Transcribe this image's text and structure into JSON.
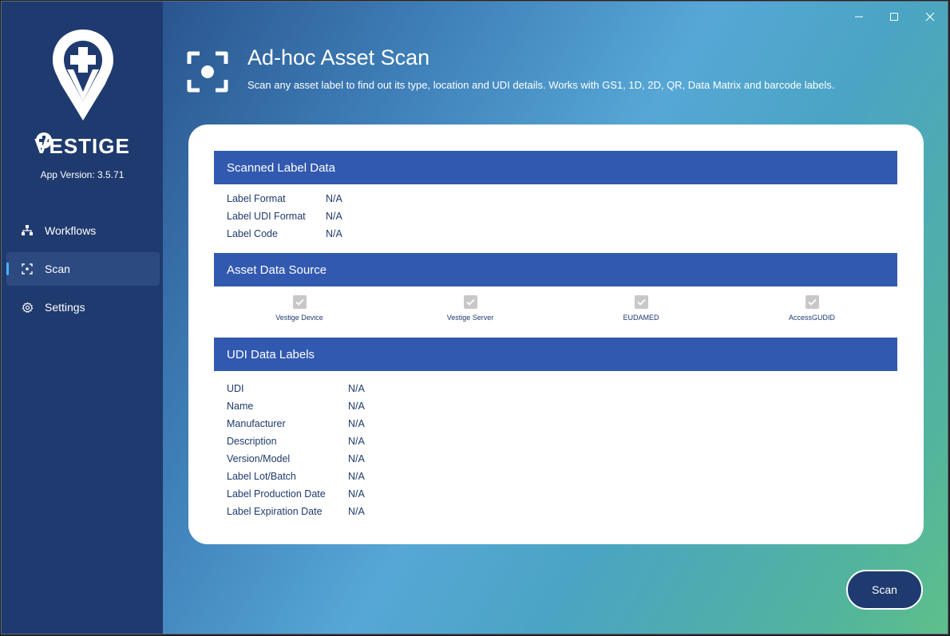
{
  "app": {
    "brand": "VESTIGE",
    "version": "App Version: 3.5.71"
  },
  "sidebar": {
    "items": [
      {
        "label": "Workflows",
        "icon": "workflow-icon"
      },
      {
        "label": "Scan",
        "icon": "scan-icon",
        "active": true
      },
      {
        "label": "Settings",
        "icon": "gear-icon"
      }
    ]
  },
  "titlebar": {
    "minimize": "minimize-icon",
    "maximize": "maximize-icon",
    "close": "close-icon"
  },
  "page": {
    "title": "Ad-hoc Asset Scan",
    "subtitle": "Scan any asset label to find out its type, location and UDI details. Works with GS1, 1D, 2D, QR, Data Matrix and barcode labels."
  },
  "scanned": {
    "heading": "Scanned Label Data",
    "rows": [
      {
        "key": "Label Format",
        "value": "N/A"
      },
      {
        "key": "Label UDI Format",
        "value": "N/A"
      },
      {
        "key": "Label Code",
        "value": "N/A"
      }
    ]
  },
  "sources": {
    "heading": "Asset Data Source",
    "items": [
      {
        "label": "Vestige Device",
        "checked": true
      },
      {
        "label": "Vestige Server",
        "checked": true
      },
      {
        "label": "EUDAMED",
        "checked": true
      },
      {
        "label": "AccessGUDID",
        "checked": true
      }
    ]
  },
  "udi": {
    "heading": "UDI Data Labels",
    "rows": [
      {
        "key": "UDI",
        "value": "N/A"
      },
      {
        "key": "Name",
        "value": "N/A"
      },
      {
        "key": "Manufacturer",
        "value": "N/A"
      },
      {
        "key": "Description",
        "value": "N/A"
      },
      {
        "key": "Version/Model",
        "value": "N/A"
      },
      {
        "key": "Label Lot/Batch",
        "value": "N/A"
      },
      {
        "key": "Label Production Date",
        "value": "N/A"
      },
      {
        "key": "Label Expiration Date",
        "value": "N/A"
      }
    ]
  },
  "actions": {
    "scan_label": "Scan"
  },
  "colors": {
    "sidebar": "#1f3a6f",
    "section_header": "#3259b0",
    "text": "#1e3a6e",
    "active_indicator": "#4ab1ff"
  }
}
